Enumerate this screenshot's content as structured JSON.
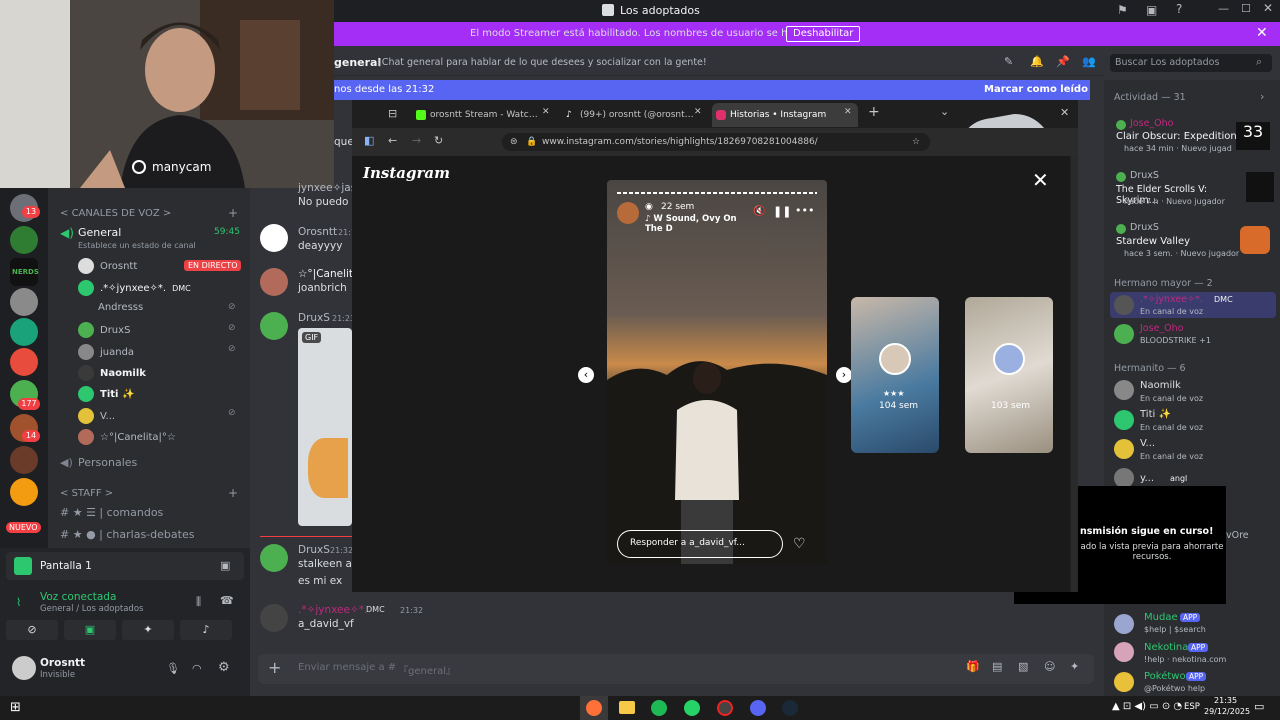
{
  "window": {
    "title": "Los adoptados"
  },
  "streamer_banner": {
    "message": "El modo Streamer está habilitado. Los nombres de usuario se han truncado.",
    "disable_label": "Deshabilitar"
  },
  "webcam": {
    "logo_text": "manycam"
  },
  "servers": {
    "badges": [
      "13",
      "177",
      "14"
    ],
    "new_label": "NUEVO",
    "nerds_label": "NERDS"
  },
  "channels": {
    "voice_category": "CANALES DE VOZ",
    "general": {
      "name": "General",
      "status_hint": "Establece un estado de canal",
      "timer": "59:45"
    },
    "voice_users": [
      {
        "name": "Orosntt",
        "live": "EN DIRECTO"
      },
      {
        "name": ".*✧jynxee✧*.",
        "tag": "DMC"
      },
      {
        "name": "Andresss"
      },
      {
        "name": "DruxS"
      },
      {
        "name": "juanda"
      },
      {
        "name": "Naomilk"
      },
      {
        "name": "Titi ✨"
      },
      {
        "name": "V..."
      },
      {
        "name": "☆°|Canelita|°☆"
      }
    ],
    "personales": "Personales",
    "staff_category": "STAFF",
    "text_channels": [
      "comandos",
      "charlas-debates"
    ]
  },
  "stream_panel": {
    "label": "Pantalla 1"
  },
  "voice_status": {
    "title": "Voz conectada",
    "subtitle": "General / Los adoptados"
  },
  "user": {
    "name": "Orosntt",
    "status": "Invisible"
  },
  "chat": {
    "channel_name": "general",
    "topic": "¡Chat general para hablar de lo que desees y socializar con la gente!",
    "new_messages": "nos desde las 21:32",
    "mark_read": "Marcar como leído",
    "search_placeholder": "Buscar Los adoptados",
    "messages": [
      {
        "author": "jynxee✧jass",
        "text": "No puedo ha",
        "partial_prefix": "que"
      },
      {
        "author": "Orosntt",
        "time": "21:1",
        "text": "deayyyy"
      },
      {
        "author": "☆°|Canelita",
        "text": "joanbrich"
      },
      {
        "author": "DruxS",
        "time": "21:23",
        "gif": "GIF"
      },
      {
        "author": "DruxS",
        "time": "21:32",
        "lines": [
          "stalkeen a o",
          "es mi ex"
        ]
      },
      {
        "author": ".*✧jynxee✧*.",
        "tag": "DMC",
        "time": "21:32",
        "text": "a_david_vf"
      }
    ],
    "composer_placeholder": "Enviar mensaje a #",
    "composer_channel": "『general』"
  },
  "members": {
    "activity_header": "Actividad — 31",
    "activities": [
      {
        "user": "Jose_Oho",
        "game": "Clair Obscur: Expedition 33",
        "meta": "hace 34 min · Nuevo jugad"
      },
      {
        "user": "DruxS",
        "game": "The Elder Scrolls V: Skyrim...",
        "meta": "hace 7 h · Nuevo jugador"
      },
      {
        "user": "DruxS",
        "game": "Stardew Valley",
        "meta": "hace 3 sem. · Nuevo jugador"
      }
    ],
    "group1": "Hermano mayor — 2",
    "group1_members": [
      {
        "name": ".*✧jynxee✧*.",
        "tag": "DMC",
        "sub": "En canal de voz"
      },
      {
        "name": "Jose_Oho",
        "sub": "BLOODSTRIKE +1"
      }
    ],
    "group2": "Hermanito — 6",
    "group2_members": [
      {
        "name": "Naomilk",
        "sub": "En canal de voz"
      },
      {
        "name": "Titi ✨",
        "sub": "En canal de voz"
      },
      {
        "name": "V...",
        "sub": "En canal de voz"
      },
      {
        "name": "y...",
        "tag": "angl"
      }
    ],
    "bots": [
      {
        "name": "Mudae",
        "tag": "APP",
        "sub": "$help | $search"
      },
      {
        "name": "Nekotina",
        "tag": "APP",
        "sub": "!help · nekotina.com"
      },
      {
        "name": "Pokétwo",
        "tag": "APP",
        "sub": "@Pokétwo help"
      }
    ]
  },
  "browser": {
    "tabs": [
      "orosntt Stream - Watch Live on",
      "(99+) orosntt (@orosntt) | TikTok",
      "Historias • Instagram"
    ],
    "url": "www.instagram.com/stories/highlights/18269708281004886/",
    "ig_logo": "Instagram",
    "story": {
      "age": "22 sem",
      "song": "W Sound, Ovy On The D",
      "reply_placeholder": "Responder a a_david_vf..."
    },
    "thumbs": [
      {
        "label": "104 sem",
        "marks": "★★★"
      },
      {
        "label": "103 sem"
      }
    ]
  },
  "preview_notice": {
    "line1": "nsmisión sigue en curso!",
    "line2": "ado la vista previa para ahorrarte recursos.",
    "line3": "vOre"
  },
  "taskbar": {
    "lang": "ESP",
    "time": "21:35",
    "date": "29/12/2025"
  }
}
